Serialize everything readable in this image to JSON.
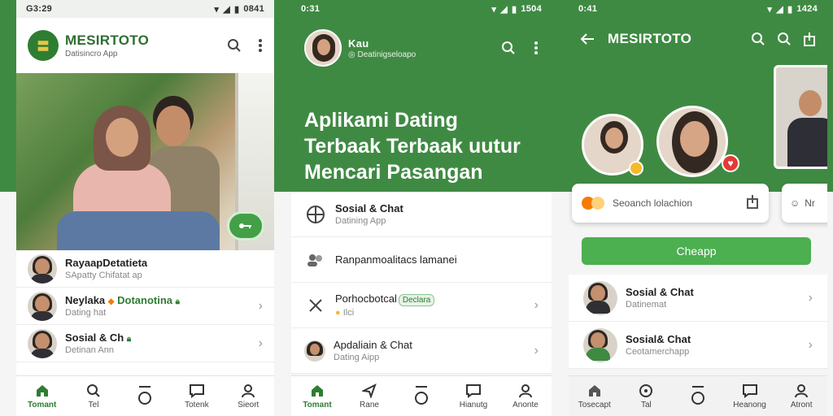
{
  "colors": {
    "brand_green": "#3f8a43",
    "accent_green": "#4caf50",
    "heart_red": "#e53935",
    "coin_yellow": "#f5b92c"
  },
  "screen1": {
    "status": {
      "time": "G3:29",
      "right": "0841"
    },
    "app_title": "MESIRTOTO",
    "app_subtitle": "Datisincro App",
    "list": [
      {
        "title": "RayaapDetatieta",
        "title_extra": "",
        "subtitle": "SApatty Chifatat ap"
      },
      {
        "title": "Neylaka",
        "title_extra": "Dotanotina",
        "subtitle": "Dating hat"
      },
      {
        "title": "Sosial & Ch",
        "title_extra": "",
        "subtitle": "Detinan Ann"
      }
    ],
    "nav": [
      "Tomant",
      "Tel",
      "",
      "Totenk",
      "Sieort"
    ]
  },
  "screen2": {
    "status": {
      "time": "0:31",
      "right": "1504"
    },
    "profile_name": "Kau",
    "profile_sub": "Deatinigseloapo",
    "headline": "Aplikami Dating Terbaak Terbaak uutur Mencari Pasangan",
    "list": [
      {
        "title": "Sosial & Chat",
        "subtitle": "Datining App",
        "badge": ""
      },
      {
        "title": "Ranpanmoalitacs lamanei",
        "subtitle": "",
        "badge": ""
      },
      {
        "title": "Porhocbotcal",
        "subtitle": "Ilci",
        "badge": "Declara"
      },
      {
        "title": "Apdaliain & Chat",
        "subtitle": "Dating Aipp",
        "badge": ""
      }
    ],
    "nav": [
      "Tomant",
      "Rane",
      "",
      "Hianutg",
      "Anonte"
    ]
  },
  "screen3": {
    "status": {
      "time": "0:41",
      "right": "1424"
    },
    "app_title": "MESIRTOTO",
    "search_label": "Seoanch lolachion",
    "side_label": "Nr",
    "cheap_button": "Cheapp",
    "list": [
      {
        "title": "Sosial & Chat",
        "subtitle": "Datinemat",
        "highlight": true
      },
      {
        "title": "Sosial& Chat",
        "subtitle": "Ceotamerchapp",
        "highlight": false
      }
    ],
    "nav": [
      "Tosecapt",
      "Tal",
      "",
      "Heanong",
      "Atront"
    ]
  }
}
